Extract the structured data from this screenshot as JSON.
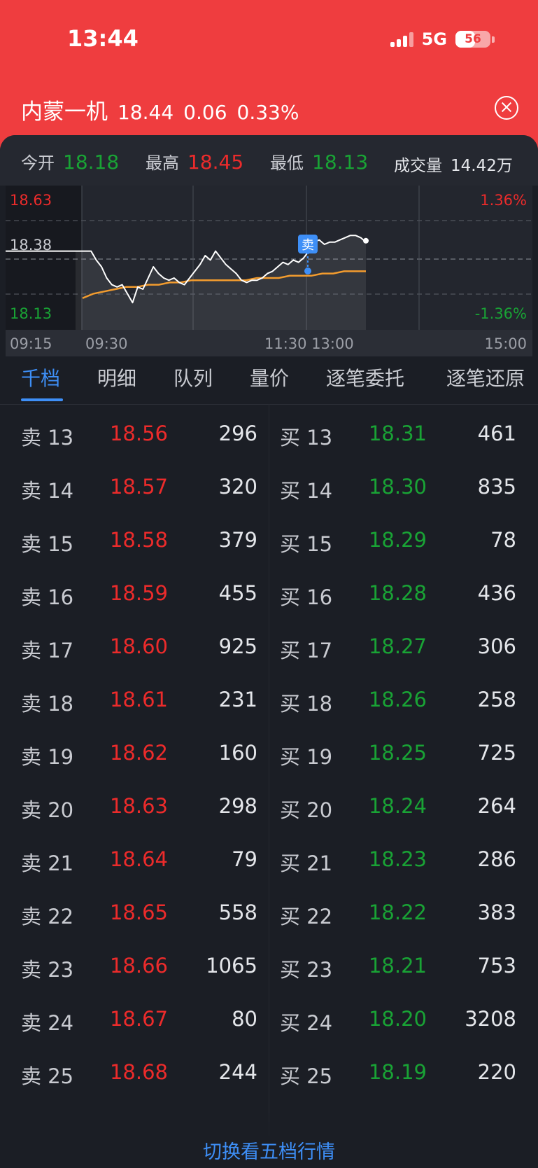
{
  "status": {
    "time": "13:44",
    "network": "5G",
    "battery": "56"
  },
  "stock": {
    "name": "内蒙一机",
    "price": "18.44",
    "change": "0.06",
    "change_pct": "0.33%"
  },
  "stats": {
    "open_label": "今开",
    "open": "18.18",
    "high_label": "最高",
    "high": "18.45",
    "low_label": "最低",
    "low": "18.13",
    "volume_label": "成交量",
    "volume": "14.42万"
  },
  "chart": {
    "price_high": "18.63",
    "price_mid": "18.38",
    "price_low": "18.13",
    "pct_high": "1.36%",
    "pct_low": "-1.36%",
    "t1": "09:15",
    "t2": "09:30",
    "t3": "11:30 13:00",
    "t4": "15:00",
    "marker_label": "卖"
  },
  "chart_data": {
    "type": "line",
    "ylim": [
      18.13,
      18.63
    ],
    "x": [
      "09:15",
      "09:30",
      "11:30 13:00",
      "15:00"
    ],
    "series": [
      {
        "values": [
          18.4,
          18.4,
          18.4,
          18.4,
          18.36,
          18.33,
          18.28,
          18.25,
          18.24,
          18.25,
          18.21,
          18.17,
          18.24,
          18.23,
          18.28,
          18.33,
          18.3,
          18.28,
          18.27,
          18.28,
          18.26,
          18.25,
          18.28,
          18.31,
          18.34,
          18.38,
          18.36,
          18.4,
          18.37,
          18.34,
          18.32,
          18.3,
          18.27,
          18.26,
          18.27,
          18.27,
          18.28,
          18.3,
          18.31,
          18.33,
          18.35,
          18.34,
          18.36,
          18.35,
          18.37,
          18.4,
          18.44,
          18.45,
          18.43,
          18.44,
          18.44,
          18.45,
          18.46,
          18.47,
          18.47,
          18.46,
          18.44
        ]
      },
      {
        "values": [
          18.19,
          18.21,
          18.22,
          18.23,
          18.24,
          18.24,
          18.25,
          18.25,
          18.26,
          18.26,
          18.27,
          18.27,
          18.27,
          18.27,
          18.27,
          18.27,
          18.28,
          18.28,
          18.28,
          18.29,
          18.29,
          18.29,
          18.3,
          18.3,
          18.31,
          18.31,
          18.31
        ]
      }
    ]
  },
  "tabs": [
    "千档",
    "明细",
    "队列",
    "量价",
    "逐笔委托",
    "逐笔还原"
  ],
  "asks": [
    [
      "卖 13",
      "18.56",
      "296"
    ],
    [
      "卖 14",
      "18.57",
      "320"
    ],
    [
      "卖 15",
      "18.58",
      "379"
    ],
    [
      "卖 16",
      "18.59",
      "455"
    ],
    [
      "卖 17",
      "18.60",
      "925"
    ],
    [
      "卖 18",
      "18.61",
      "231"
    ],
    [
      "卖 19",
      "18.62",
      "160"
    ],
    [
      "卖 20",
      "18.63",
      "298"
    ],
    [
      "卖 21",
      "18.64",
      "79"
    ],
    [
      "卖 22",
      "18.65",
      "558"
    ],
    [
      "卖 23",
      "18.66",
      "1065"
    ],
    [
      "卖 24",
      "18.67",
      "80"
    ],
    [
      "卖 25",
      "18.68",
      "244"
    ]
  ],
  "bids": [
    [
      "买 13",
      "18.31",
      "461"
    ],
    [
      "买 14",
      "18.30",
      "835"
    ],
    [
      "买 15",
      "18.29",
      "78"
    ],
    [
      "买 16",
      "18.28",
      "436"
    ],
    [
      "买 17",
      "18.27",
      "306"
    ],
    [
      "买 18",
      "18.26",
      "258"
    ],
    [
      "买 19",
      "18.25",
      "725"
    ],
    [
      "买 20",
      "18.24",
      "264"
    ],
    [
      "买 21",
      "18.23",
      "286"
    ],
    [
      "买 22",
      "18.22",
      "383"
    ],
    [
      "买 23",
      "18.21",
      "753"
    ],
    [
      "买 24",
      "18.20",
      "3208"
    ],
    [
      "买 25",
      "18.19",
      "220"
    ]
  ],
  "footer": {
    "switch_label": "切换看五档行情"
  }
}
